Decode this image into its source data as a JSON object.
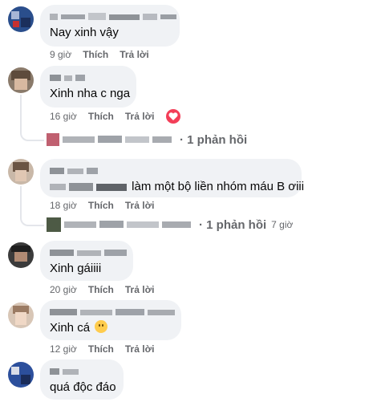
{
  "colors": {
    "bubble": "#f0f2f5",
    "meta": "#65676b",
    "heart": "#f33e58",
    "line": "#e4e6eb"
  },
  "comments": [
    {
      "text": "Nay xinh vậy",
      "time": "9 giờ",
      "like": "Thích",
      "reply": "Trả lời"
    },
    {
      "text": "Xinh nha c nga",
      "time": "16 giờ",
      "like": "Thích",
      "reply": "Trả lời",
      "reaction_icon": "heart-icon",
      "replies": "· 1 phản hồi"
    },
    {
      "text": "làm một bộ liền nhóm máu B ơiii",
      "time": "18 giờ",
      "like": "Thích",
      "reply": "Trả lời",
      "replies": "· 1 phản hồi",
      "reply_time": "7 giờ"
    },
    {
      "text": "Xinh gáiiii",
      "time": "20 giờ",
      "like": "Thích",
      "reply": "Trả lời"
    },
    {
      "text": "Xinh cá",
      "emoji_icon": "smiling-emoji-icon",
      "time": "12 giờ",
      "like": "Thích",
      "reply": "Trả lời"
    },
    {
      "text": "quá độc đáo"
    }
  ]
}
